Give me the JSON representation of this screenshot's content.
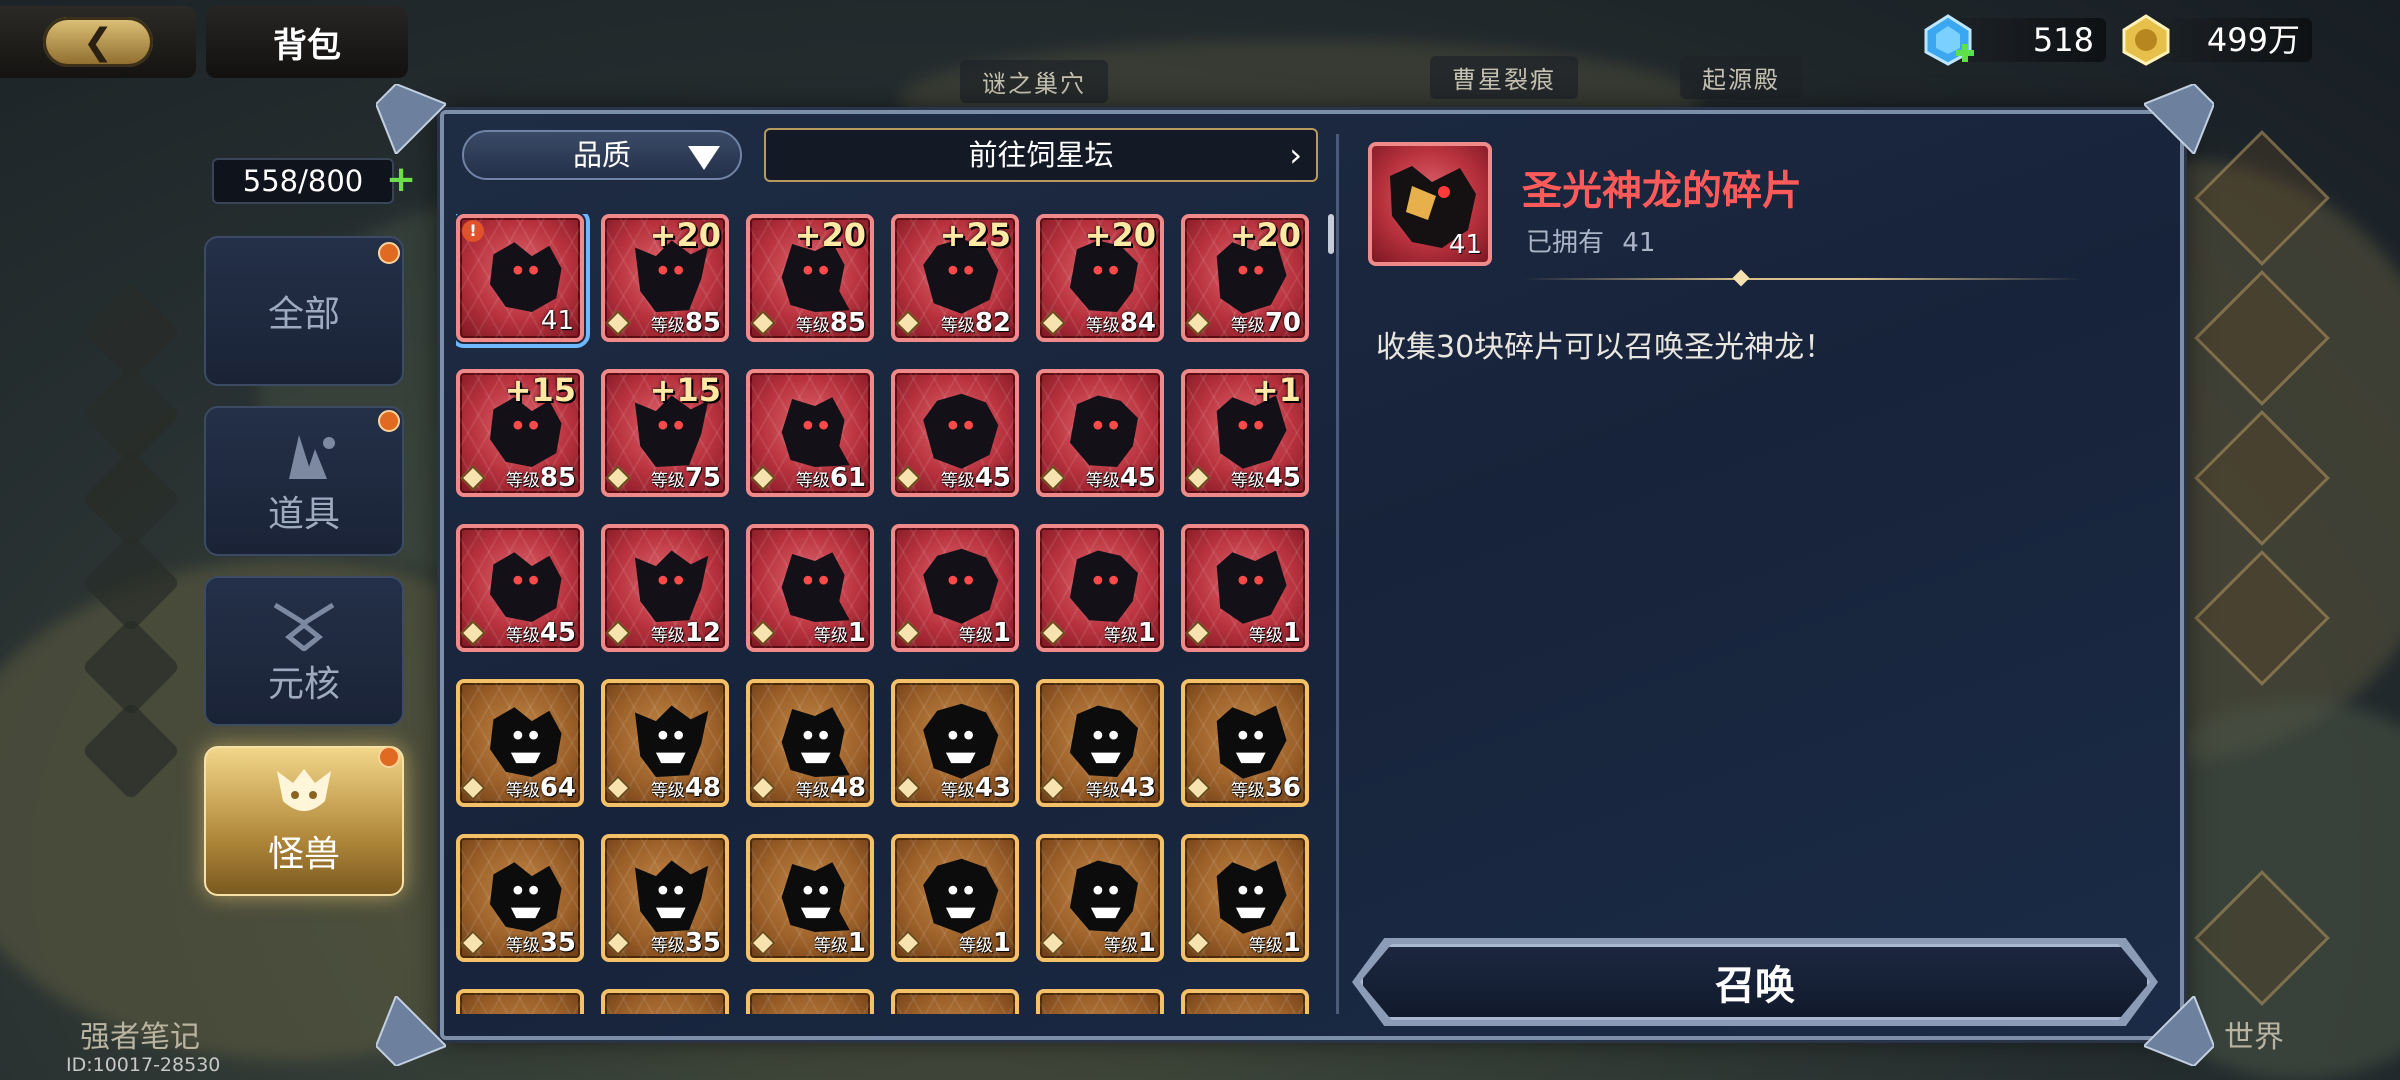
{
  "header": {
    "title": "背包",
    "back_icon": "back-arrow-icon"
  },
  "currency": {
    "diamonds": "518",
    "gold": "499万"
  },
  "background": {
    "labels": [
      "谜之巢穴",
      "曹星裂痕",
      "起源殿"
    ],
    "bottom_left_label": "强者笔记",
    "bottom_right_label": "世界"
  },
  "inventory": {
    "capacity": "558/800",
    "tabs": [
      {
        "label": "全部",
        "icon": "all-grid-icon",
        "active": false
      },
      {
        "label": "道具",
        "icon": "items-icon",
        "active": false
      },
      {
        "label": "元核",
        "icon": "core-icon",
        "active": false
      },
      {
        "label": "怪兽",
        "icon": "monster-icon",
        "active": true
      }
    ]
  },
  "filters": {
    "quality_label": "品质",
    "goto_label": "前往饲星坛"
  },
  "grid": {
    "rows": [
      [
        {
          "rarity": "red",
          "count": "41",
          "plus": "",
          "level": "",
          "selected": true,
          "warn": true
        },
        {
          "rarity": "red",
          "count": "",
          "plus": "+20",
          "level": "85",
          "selected": false,
          "warn": false
        },
        {
          "rarity": "red",
          "count": "",
          "plus": "+20",
          "level": "85",
          "selected": false,
          "warn": false
        },
        {
          "rarity": "red",
          "count": "",
          "plus": "+25",
          "level": "82",
          "selected": false,
          "warn": false
        },
        {
          "rarity": "red",
          "count": "",
          "plus": "+20",
          "level": "84",
          "selected": false,
          "warn": false
        },
        {
          "rarity": "red",
          "count": "",
          "plus": "+20",
          "level": "70",
          "selected": false,
          "warn": false
        }
      ],
      [
        {
          "rarity": "red",
          "count": "",
          "plus": "+15",
          "level": "85",
          "selected": false,
          "warn": false
        },
        {
          "rarity": "red",
          "count": "",
          "plus": "+15",
          "level": "75",
          "selected": false,
          "warn": false
        },
        {
          "rarity": "red",
          "count": "",
          "plus": "",
          "level": "61",
          "selected": false,
          "warn": false
        },
        {
          "rarity": "red",
          "count": "",
          "plus": "",
          "level": "45",
          "selected": false,
          "warn": false
        },
        {
          "rarity": "red",
          "count": "",
          "plus": "",
          "level": "45",
          "selected": false,
          "warn": false
        },
        {
          "rarity": "red",
          "count": "",
          "plus": "+1",
          "level": "45",
          "selected": false,
          "warn": false
        }
      ],
      [
        {
          "rarity": "red",
          "count": "",
          "plus": "",
          "level": "45",
          "selected": false,
          "warn": false
        },
        {
          "rarity": "red",
          "count": "",
          "plus": "",
          "level": "12",
          "selected": false,
          "warn": false
        },
        {
          "rarity": "red",
          "count": "",
          "plus": "",
          "level": "1",
          "selected": false,
          "warn": false
        },
        {
          "rarity": "red",
          "count": "",
          "plus": "",
          "level": "1",
          "selected": false,
          "warn": false
        },
        {
          "rarity": "red",
          "count": "",
          "plus": "",
          "level": "1",
          "selected": false,
          "warn": false
        },
        {
          "rarity": "red",
          "count": "",
          "plus": "",
          "level": "1",
          "selected": false,
          "warn": false
        }
      ],
      [
        {
          "rarity": "gold",
          "count": "",
          "plus": "",
          "level": "64",
          "selected": false,
          "warn": false
        },
        {
          "rarity": "gold",
          "count": "",
          "plus": "",
          "level": "48",
          "selected": false,
          "warn": false
        },
        {
          "rarity": "gold",
          "count": "",
          "plus": "",
          "level": "48",
          "selected": false,
          "warn": false
        },
        {
          "rarity": "gold",
          "count": "",
          "plus": "",
          "level": "43",
          "selected": false,
          "warn": false
        },
        {
          "rarity": "gold",
          "count": "",
          "plus": "",
          "level": "43",
          "selected": false,
          "warn": false
        },
        {
          "rarity": "gold",
          "count": "",
          "plus": "",
          "level": "36",
          "selected": false,
          "warn": false
        }
      ],
      [
        {
          "rarity": "gold",
          "count": "",
          "plus": "",
          "level": "35",
          "selected": false,
          "warn": false
        },
        {
          "rarity": "gold",
          "count": "",
          "plus": "",
          "level": "35",
          "selected": false,
          "warn": false
        },
        {
          "rarity": "gold",
          "count": "",
          "plus": "",
          "level": "1",
          "selected": false,
          "warn": false
        },
        {
          "rarity": "gold",
          "count": "",
          "plus": "",
          "level": "1",
          "selected": false,
          "warn": false
        },
        {
          "rarity": "gold",
          "count": "",
          "plus": "",
          "level": "1",
          "selected": false,
          "warn": false
        },
        {
          "rarity": "gold",
          "count": "",
          "plus": "",
          "level": "1",
          "selected": false,
          "warn": false
        }
      ],
      [
        {
          "rarity": "gold",
          "count": "",
          "plus": "",
          "level": "",
          "selected": false,
          "warn": false
        },
        {
          "rarity": "gold",
          "count": "",
          "plus": "",
          "level": "",
          "selected": false,
          "warn": false
        },
        {
          "rarity": "gold",
          "count": "",
          "plus": "",
          "level": "",
          "selected": false,
          "warn": false
        },
        {
          "rarity": "gold",
          "count": "",
          "plus": "",
          "level": "",
          "selected": false,
          "warn": false
        },
        {
          "rarity": "gold",
          "count": "",
          "plus": "",
          "level": "",
          "selected": false,
          "warn": false
        },
        {
          "rarity": "gold",
          "count": "",
          "plus": "",
          "level": "",
          "selected": false,
          "warn": false
        }
      ]
    ],
    "level_prefix": "等级"
  },
  "detail": {
    "name": "圣光神龙的碎片",
    "owned_label": "已拥有",
    "owned_count": "41",
    "icon_count": "41",
    "description": "收集30块碎片可以召唤圣光神龙！",
    "summon_label": "召唤"
  },
  "footer": {
    "uid": "ID:10017-28530"
  },
  "colors": {
    "detail_name": "#ff5a5a",
    "red_rarity": "#b8323e",
    "gold_rarity": "#9a5e28",
    "active_tab": "#d9b25c"
  }
}
